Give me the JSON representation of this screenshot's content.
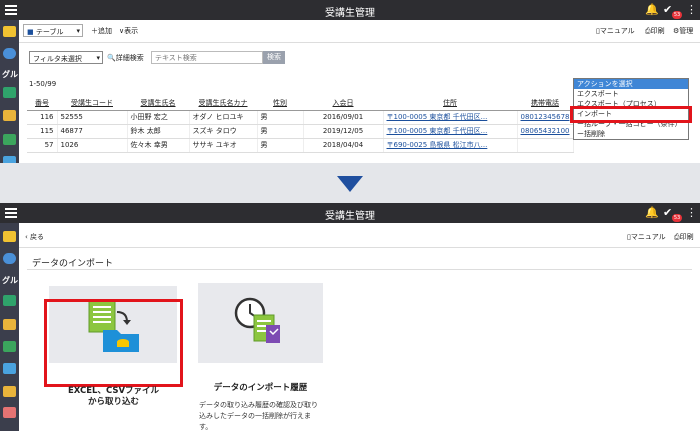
{
  "top": {
    "title": "受講生管理",
    "notification_badge": "53",
    "toolbar": {
      "view_select": "テーブル",
      "add_label": "追加",
      "display_label": "表示",
      "manual_label": "マニュアル",
      "print_label": "印刷",
      "admin_label": "管理"
    },
    "filter": {
      "select_value": "フィルタ未選択",
      "advanced_search_label": "詳細検索",
      "search_placeholder": "テキスト検索",
      "search_button": "検索"
    },
    "range_text": "1-50/99",
    "action_menu": {
      "selected": "アクションを選択",
      "options": [
        "アクションを選択",
        "エクスポート",
        "エクスポート（プロセス）",
        "インポート",
        "ー括ループ・一括コピー（条件）",
        "ー括削除"
      ]
    },
    "table": {
      "headers": [
        "番号",
        "受講生コード",
        "受講生氏名",
        "受講生氏名カナ",
        "性別",
        "入会日",
        "住所",
        "携帯電話"
      ],
      "rows": [
        [
          "116",
          "52555",
          "小田野 宏之",
          "オダノ ヒロユキ",
          "男",
          "2016/09/01",
          "〒100-0005 東京都 千代田区...",
          "08012345678"
        ],
        [
          "115",
          "46877",
          "鈴木 太郎",
          "スズキ タロウ",
          "男",
          "2019/12/05",
          "〒100-0005 東京都 千代田区...",
          "08065432100"
        ],
        [
          "57",
          "1026",
          "佐々木 幸男",
          "ササキ ユキオ",
          "男",
          "2018/04/04",
          "〒690-0025 島根県 松江市八...",
          ""
        ]
      ]
    }
  },
  "bottom": {
    "title": "受講生管理",
    "notification_badge": "53",
    "back_label": "戻る",
    "manual_label": "マニュアル",
    "print_label": "印刷",
    "section_heading": "データのインポート",
    "card1": {
      "title_line1": "EXCEL、CSVファイル",
      "title_line2": "から取り込む"
    },
    "card2": {
      "title": "データのインポート履歴",
      "desc_line1": "データの取り込み履歴の確認及び取り",
      "desc_line2": "込みしたデータの一括削除が行えま",
      "desc_line3": "す。"
    }
  },
  "sidebar_label": "グル",
  "colors": {
    "titlebar": "#2d2d31",
    "sidebar": "#3b3e4c",
    "highlight": "#e2141b",
    "arrow": "#1f4f9f",
    "link": "#1b4f9c"
  }
}
